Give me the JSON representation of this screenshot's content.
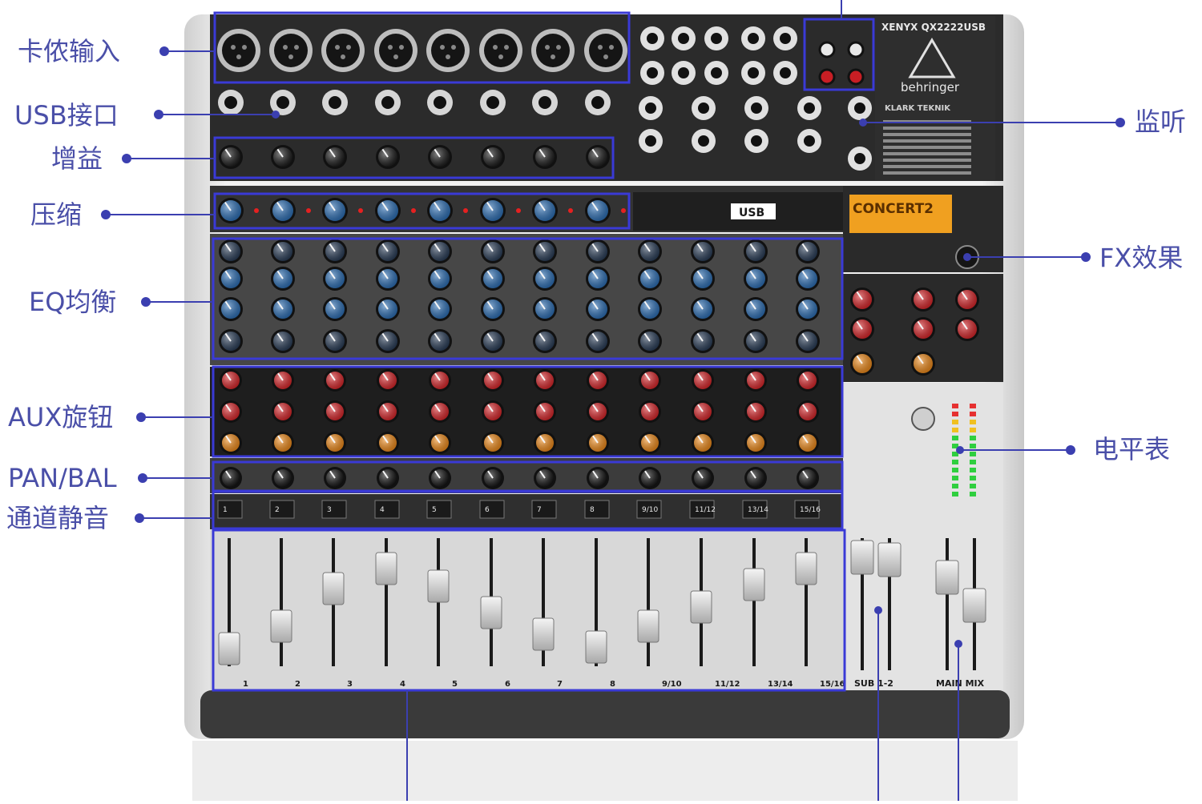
{
  "callouts": {
    "left": {
      "xlr_input": "卡侬输入",
      "usb_port": "USB接口",
      "gain": "增益",
      "compressor": "压缩",
      "eq": "EQ均衡",
      "aux_knobs": "AUX旋钮",
      "pan_bal": "PAN/BAL",
      "channel_mute": "通道静音"
    },
    "right": {
      "monitor": "监听",
      "fx": "FX效果",
      "level_meter": "电平表"
    }
  },
  "device": {
    "model": "XENYX QX2222USB",
    "brand": "behringer",
    "fx_brand": "KLARK TEKNIK",
    "display_text": "CONCERT2",
    "usb_badge": "USB",
    "channel_labels": [
      "1",
      "2",
      "3",
      "4",
      "5",
      "6",
      "7",
      "8",
      "9/10",
      "11/12",
      "13/14",
      "15/16"
    ],
    "bus_labels": {
      "sub": "SUB 1-2",
      "main": "MAIN MIX"
    }
  },
  "colors": {
    "label": "#4a4fa8",
    "callout_line": "#3b3fb0",
    "highlight_box": "#3a3ad6",
    "panel_dark": "#2a2a2a",
    "panel_light": "#d9d9d9",
    "knob_blue": "#2d6fb5",
    "knob_red": "#d8262a",
    "knob_orange": "#ee8a1a",
    "display_orange": "#f0a020"
  }
}
